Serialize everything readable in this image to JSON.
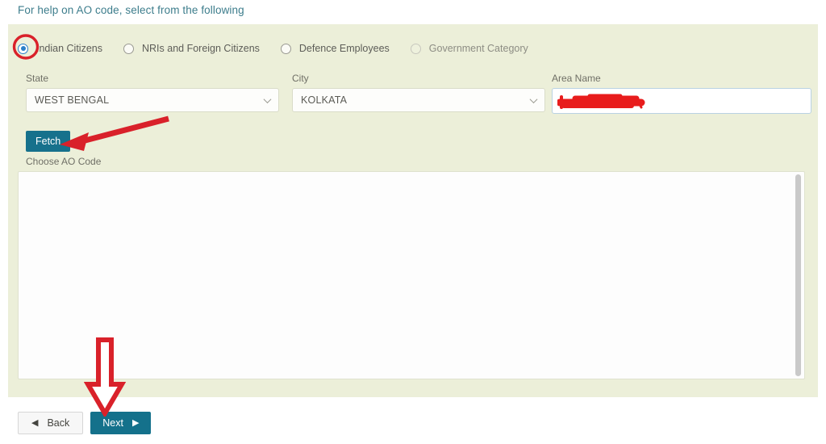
{
  "help": {
    "heading": "For help on AO code, select from the following"
  },
  "categories": {
    "options": [
      {
        "label": "Indian Citizens",
        "selected": true,
        "faded": false
      },
      {
        "label": "NRIs and Foreign Citizens",
        "selected": false,
        "faded": false
      },
      {
        "label": "Defence Employees",
        "selected": false,
        "faded": false
      },
      {
        "label": "Government Category",
        "selected": false,
        "faded": true
      }
    ]
  },
  "form": {
    "state": {
      "label": "State",
      "value": "WEST BENGAL"
    },
    "city": {
      "label": "City",
      "value": "KOLKATA"
    },
    "area": {
      "label": "Area Name",
      "value": "",
      "redacted": true
    }
  },
  "actions": {
    "fetch_label": "Fetch",
    "choose_label": "Choose AO Code",
    "back_label": "Back",
    "next_label": "Next",
    "back_arrow": "◀",
    "next_arrow": "▶"
  },
  "listbox": {
    "items": [],
    "scroll_position": 0
  },
  "annotations": {
    "radio_circle": "highlight-circle-indian-citizens",
    "fetch_arrow": "arrow-pointing-to-fetch",
    "next_arrow": "arrow-pointing-to-next"
  },
  "colors": {
    "panel_bg": "#ecefd9",
    "heading": "#3d7d8c",
    "teal_button": "#16718c",
    "annotation_red": "#e02020",
    "radio_blue": "#2a7fc9"
  }
}
